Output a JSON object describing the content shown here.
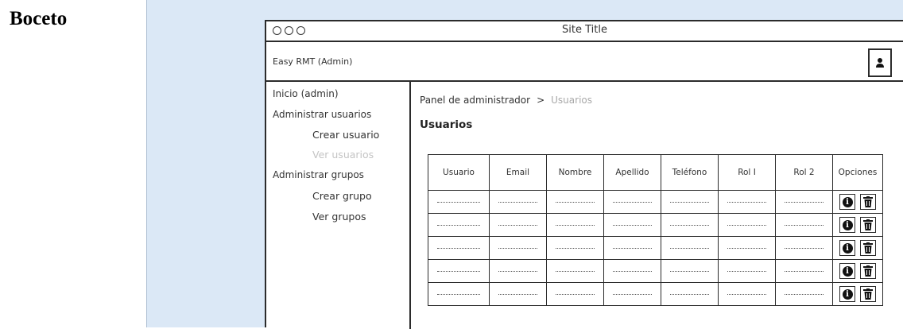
{
  "doc": {
    "label": "Boceto"
  },
  "window": {
    "title": "Site Title"
  },
  "header": {
    "brand": "Easy RMT (Admin)",
    "user_icon": "user-icon"
  },
  "sidebar": {
    "items": [
      {
        "label": "Inicio (admin)"
      },
      {
        "label": "Administrar usuarios"
      },
      {
        "label": "Crear usuario"
      },
      {
        "label": "Ver usuarios"
      },
      {
        "label": "Administrar grupos"
      },
      {
        "label": "Crear grupo"
      },
      {
        "label": "Ver grupos"
      }
    ]
  },
  "breadcrumb": {
    "parent": "Panel de administrador",
    "separator": ">",
    "current": "Usuarios"
  },
  "page": {
    "title": "Usuarios"
  },
  "table": {
    "headers": [
      "Usuario",
      "Email",
      "Nombre",
      "Apellido",
      "Teléfono",
      "Rol I",
      "Rol 2",
      "Opciones"
    ],
    "row_count": 5,
    "option_icons": [
      "info-icon",
      "trash-icon"
    ]
  }
}
